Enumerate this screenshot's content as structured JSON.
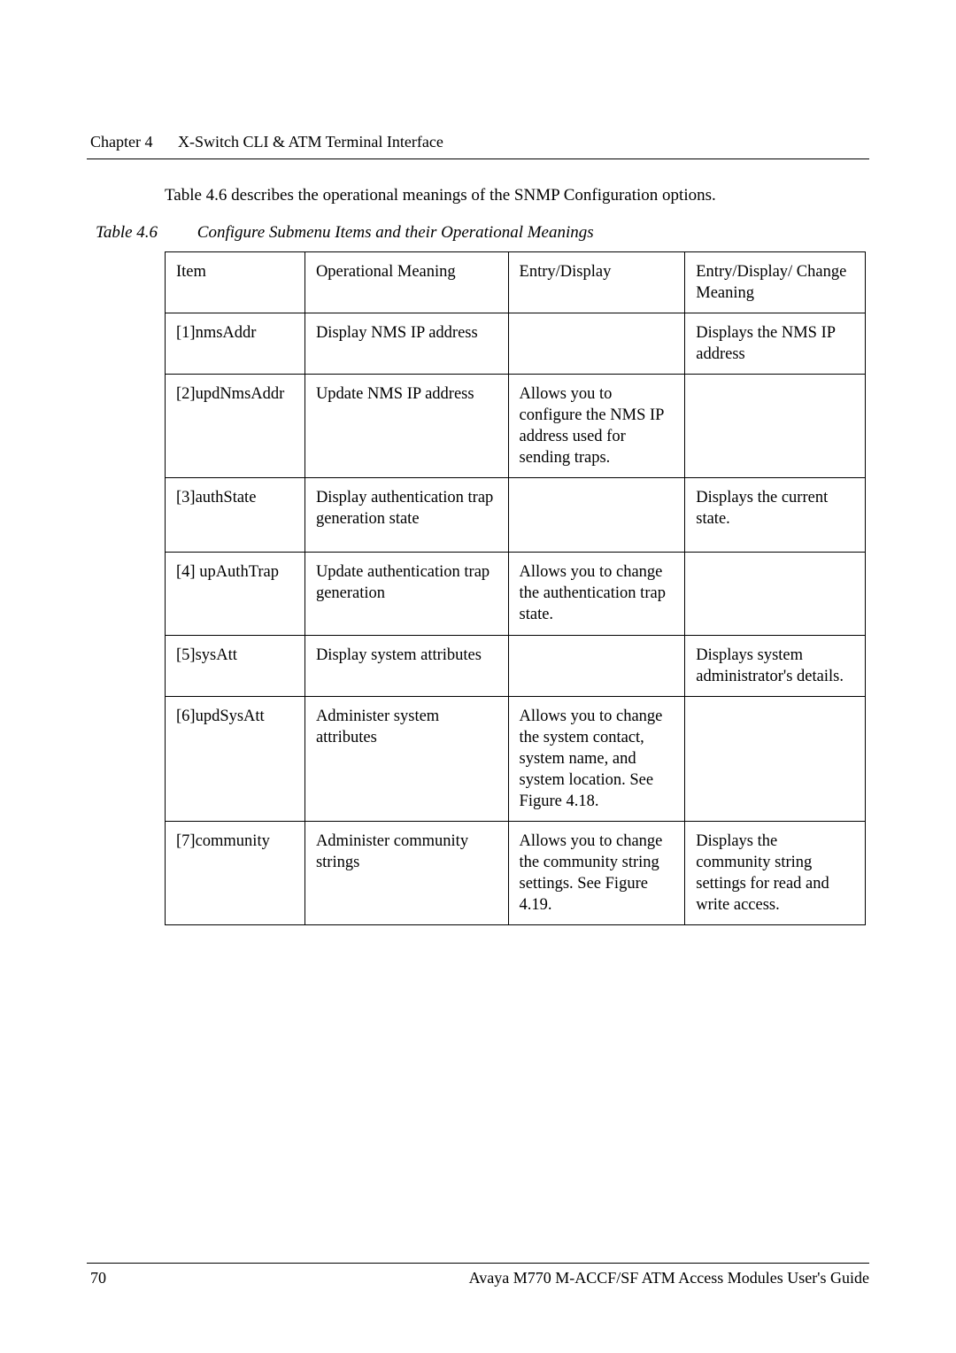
{
  "header": {
    "chapter_label": "Chapter 4",
    "chapter_title": "X-Switch CLI & ATM Terminal Interface"
  },
  "intro": "Table 4.6 describes the operational meanings of the SNMP Configuration options.",
  "table_caption": {
    "label": "Table 4.6",
    "title": "Configure Submenu Items and their Operational Meanings"
  },
  "table": {
    "headers": [
      "Item",
      "Operational Meaning",
      "Entry/Display",
      "Entry/Display/ Change Meaning"
    ],
    "rows": [
      {
        "item": "[1]nmsAddr",
        "op": "Display NMS IP address",
        "entry": "",
        "change": "Displays the NMS IP address"
      },
      {
        "item": "[2]updNmsAddr",
        "op": "Update NMS IP address",
        "entry": "Allows you to configure the NMS IP address used for sending traps.",
        "change": ""
      },
      {
        "item": "[3]authState",
        "op": "Display authentication trap generation state",
        "entry": "",
        "change": "Displays the current state."
      },
      {
        "item": "[4] upAuthTrap",
        "op": "Update authentication trap generation",
        "entry": "Allows you to change the authentication trap state.",
        "change": ""
      },
      {
        "item": "[5]sysAtt",
        "op": "Display system attributes",
        "entry": "",
        "change": "Displays system administrator's details."
      },
      {
        "item": "[6]updSysAtt",
        "op": "Administer system attributes",
        "entry": "Allows you to change the system contact, system name, and system location. See Figure 4.18.",
        "change": ""
      },
      {
        "item": "[7]community",
        "op": "Administer community strings",
        "entry": "Allows you to change the community string settings. See Figure 4.19.",
        "change": "Displays the community string settings for read and write access."
      }
    ]
  },
  "footer": {
    "page": "70",
    "doc_title": "Avaya M770 M-ACCF/SF ATM Access Modules User's Guide"
  }
}
